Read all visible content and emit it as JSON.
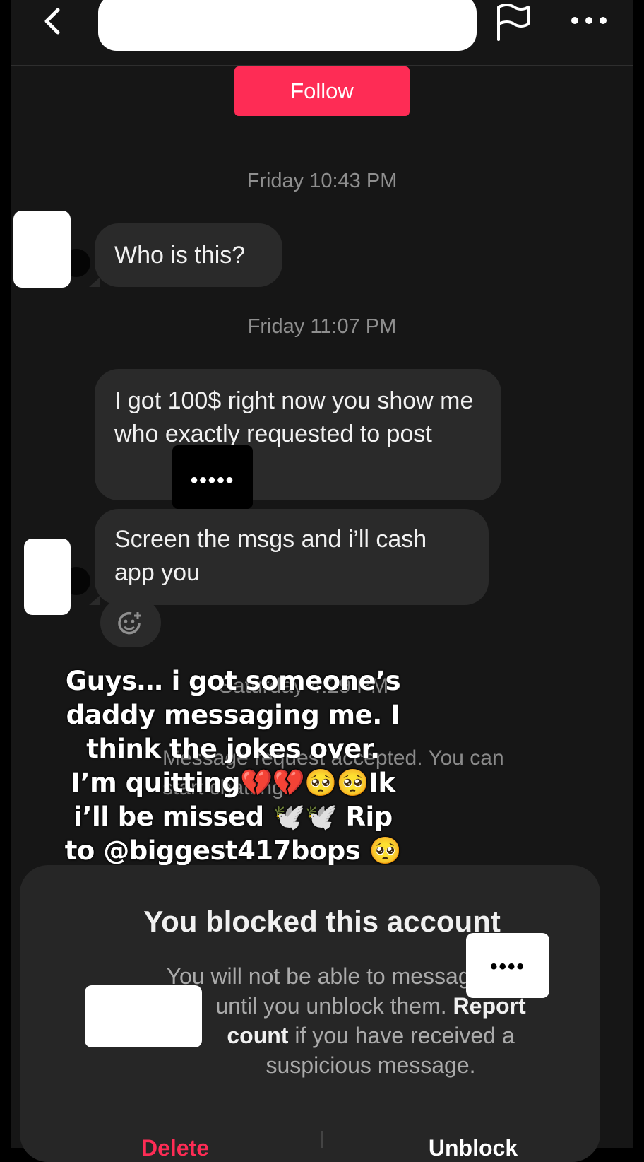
{
  "header": {
    "back_icon": "chevron-left-icon",
    "flag_icon": "flag-icon",
    "more_icon": "more-dots-icon"
  },
  "follow_label": "Follow",
  "timestamps": [
    "Friday 10:43 PM",
    "Friday 11:07 PM",
    "Saturday 4:29 PM"
  ],
  "messages": [
    "Who is this?",
    "I got 100$ right now you show me who exactly requested to post",
    "Screen the msgs and i’ll cash app you"
  ],
  "redaction_dots": "•••••",
  "redaction_dots_short": "••••",
  "system_notice": "Message request accepted. You can start chatting",
  "caption": "Guys… i got someone’s daddy messaging me. I think the jokes over. I’m quitting💔💔🥺🥺Ik i’ll be missed 🕊️🕊️ Rip to @biggest417bops 🥺🥺😢😢🫲",
  "blocked_sheet": {
    "title": "You blocked this account",
    "body_line1": "You will not be able to message",
    "body_line2_rest": "until you unblock them.",
    "report_part1": "Report",
    "report_part2": "count",
    "body_line3_rest": "if you have received a",
    "body_line4": "suspicious message.",
    "delete_label": "Delete",
    "unblock_label": "Unblock"
  },
  "colors": {
    "accent": "#fe2c55",
    "background": "#161616",
    "bubble": "#2a2a2a"
  }
}
